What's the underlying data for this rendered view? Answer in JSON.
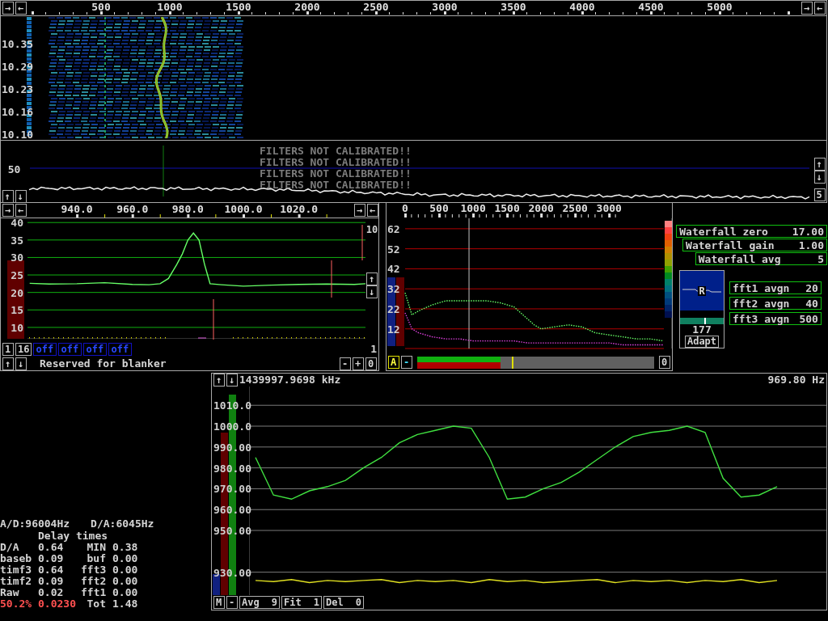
{
  "waterfall_window": {
    "left_buttons": [
      "→",
      "←"
    ],
    "right_buttons": [
      "→",
      "←"
    ],
    "freq_scale": [
      "500",
      "1000",
      "1500",
      "2000",
      "2500",
      "3000",
      "3500",
      "4000",
      "4500",
      "5000"
    ],
    "time_labels": [
      "10.35",
      "10.29",
      "10.23",
      "10.16",
      "10.10"
    ],
    "spectrum": {
      "level_label": "50",
      "left_buttons": [
        "↑",
        "↓"
      ],
      "right_buttons": [
        "↑",
        "↓"
      ],
      "right_value": "5"
    },
    "warnings": [
      "FILTERS NOT CALIBRATED!!",
      "FILTERS NOT CALIBRATED!!",
      "FILTERS NOT CALIBRATED!!",
      "FILTERS NOT CALIBRATED!!"
    ]
  },
  "baseband_window": {
    "left_buttons": [
      "→",
      "←"
    ],
    "right_buttons": [
      "→",
      "←"
    ],
    "chart_data": {
      "type": "line",
      "grid": true,
      "xlim": [
        922.2,
        1044
      ],
      "ylim": [
        7.2,
        41.2
      ],
      "xticks": [
        {
          "value": 940,
          "label": "940.0"
        },
        {
          "value": 960,
          "label": "960.0"
        },
        {
          "value": 980,
          "label": "980.0"
        },
        {
          "value": 1000,
          "label": "1000.0"
        },
        {
          "value": 1020,
          "label": "1020.0"
        }
      ],
      "yticks": [
        40,
        35,
        30,
        25,
        20,
        15,
        10
      ],
      "x": [
        923,
        930,
        940,
        950,
        960,
        966,
        970,
        973,
        976,
        978,
        980,
        982,
        984,
        986,
        988,
        992,
        1000,
        1010,
        1020,
        1030,
        1040,
        1044
      ],
      "series": [
        {
          "color": "#66ff66",
          "values": [
            22.6,
            22.4,
            22.5,
            22.8,
            22.3,
            22.2,
            22.5,
            24,
            28,
            31,
            35,
            37,
            35,
            28,
            22.5,
            22.2,
            21.8,
            22.1,
            22.3,
            22.4,
            22.3,
            22.5
          ]
        }
      ]
    },
    "side_value": "10",
    "side_buttons": [
      "↑",
      "↓"
    ],
    "counters": [
      "1",
      "16"
    ],
    "blanker_buttons": [
      "off",
      "off",
      "off",
      "off"
    ],
    "right_value": "1",
    "nav_buttons": [
      "↑",
      "↓"
    ],
    "status": "Reserved for blanker",
    "zoom_buttons": [
      "-",
      "+",
      "0"
    ]
  },
  "analyzer_window": {
    "chart_data": {
      "type": "line",
      "grid": true,
      "xlim": [
        0,
        3925
      ],
      "ylim": [
        2.2,
        67.2
      ],
      "ref_lines": [
        {
          "axis": "x",
          "value": 940,
          "color": "#c0c0c0"
        }
      ],
      "xticks": [
        0,
        500,
        1000,
        1500,
        2000,
        2500,
        3000
      ],
      "yticks": [
        62,
        52,
        42,
        32,
        22,
        12
      ],
      "x": [
        0,
        100,
        200,
        400,
        600,
        800,
        1000,
        1200,
        1400,
        1600,
        1800,
        1900,
        2000,
        2200,
        2400,
        2600,
        2800,
        3000,
        3200,
        3400,
        3600,
        3800
      ],
      "series": [
        {
          "color": "#66ff66",
          "line_style": "dotted",
          "values": [
            30,
            19,
            21,
            24,
            26,
            26,
            26,
            26,
            25,
            23,
            17,
            14,
            12,
            13,
            14,
            13,
            10,
            9,
            8,
            7,
            7,
            6
          ]
        },
        {
          "color": "#e040e0",
          "line_style": "dotted",
          "values": [
            20,
            12,
            10,
            8,
            7,
            7,
            6,
            6,
            6,
            6,
            5,
            5,
            5,
            5,
            5,
            5,
            5,
            5,
            4,
            4,
            4,
            4
          ]
        }
      ]
    },
    "mode_button": "A",
    "minus_button": "-",
    "reset_button": "0",
    "bar": {
      "level": 0.35,
      "marker": {
        "level": 0.4
      }
    }
  },
  "parameters": [
    {
      "label": "Waterfall zero",
      "value": "17.00"
    },
    {
      "label": "Waterfall gain",
      "value": "1.00"
    },
    {
      "label": "Waterfall avg",
      "value": "5"
    }
  ],
  "r_meter": {
    "label": "R",
    "value": "177",
    "button": "Adapt",
    "level": 0.55
  },
  "fft_parameters": [
    {
      "label": "fft1 avgn",
      "value": "20"
    },
    {
      "label": "fft2 avgn",
      "value": "40"
    },
    {
      "label": "fft3 avgn",
      "value": "500"
    }
  ],
  "timing": {
    "ad_rate": "A/D:96004Hz",
    "da_rate": "D/A:6045Hz",
    "title": "Delay times",
    "rows": [
      {
        "cells": [
          "D/A",
          "0.64",
          "MIN",
          "0.38"
        ],
        "alert": false
      },
      {
        "cells": [
          "baseb",
          "0.09",
          "buf",
          "0.00"
        ],
        "alert": false
      },
      {
        "cells": [
          "timf3",
          "0.64",
          "fft3",
          "0.00"
        ],
        "alert": false
      },
      {
        "cells": [
          "timf2",
          "0.09",
          "fft2",
          "0.00"
        ],
        "alert": false
      },
      {
        "cells": [
          "Raw",
          "0.02",
          "fft1",
          "0.00"
        ],
        "alert": false
      },
      {
        "cells": [
          "50.2%",
          "0.0230",
          "Tot",
          "1.48"
        ],
        "alert": true
      }
    ]
  },
  "frequency_window": {
    "buttons": [
      "↑",
      "↓"
    ],
    "frequency": "1439997.9698 kHz",
    "offset": "969.80 Hz",
    "chart_data": {
      "type": "line",
      "grid": true,
      "ylim": [
        919,
        1019
      ],
      "yticks": [
        {
          "value": 1010,
          "label": "1010.0"
        },
        {
          "value": 1000,
          "label": "1000.0"
        },
        {
          "value": 990,
          "label": "990.00"
        },
        {
          "value": 980,
          "label": "980.00"
        },
        {
          "value": 970,
          "label": "970.00"
        },
        {
          "value": 960,
          "label": "960.00"
        },
        {
          "value": 950,
          "label": "950.00"
        },
        {
          "value": 930,
          "label": "930.00"
        }
      ],
      "series": [
        {
          "color": "#40e040",
          "values": [
            985,
            967,
            965,
            969,
            971,
            974,
            980,
            985,
            992,
            996,
            998,
            1000,
            999,
            985,
            965,
            966,
            970,
            973,
            978,
            984,
            990,
            995,
            997,
            998,
            1000,
            997,
            975,
            966,
            967,
            971
          ]
        },
        {
          "color": "#e0e020",
          "values": [
            926,
            925.5,
            926.5,
            925,
            926,
            925.5,
            926,
            926.5,
            925,
            926,
            925.5,
            926,
            925,
            926.5,
            925.5,
            926,
            925,
            925.5,
            926,
            926.5,
            925,
            926,
            925.5,
            926,
            925,
            926,
            925.5,
            926.5,
            925,
            926
          ]
        }
      ]
    },
    "footer_buttons": [
      {
        "label": "M"
      },
      {
        "label": "-"
      },
      {
        "label": "Avg",
        "value": "9"
      },
      {
        "label": "Fit",
        "value": "1"
      },
      {
        "label": "Del",
        "value": "0"
      }
    ]
  }
}
